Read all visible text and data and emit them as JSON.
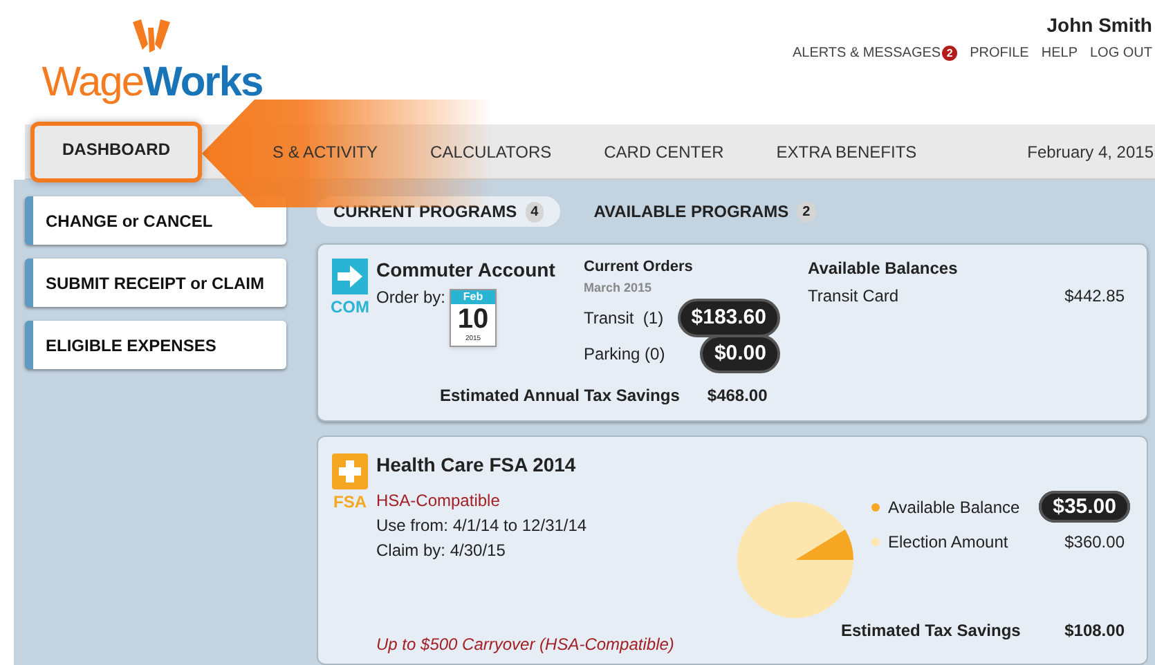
{
  "logo": {
    "part1": "Wage",
    "part2": "Works"
  },
  "user": {
    "name": "John Smith"
  },
  "top_links": [
    {
      "label": "ALERTS & MESSAGES",
      "badge": "2"
    },
    {
      "label": "PROFILE"
    },
    {
      "label": "HELP"
    },
    {
      "label": "LOG OUT"
    }
  ],
  "nav": {
    "items": [
      {
        "label": "DASHBOARD",
        "selected": true
      },
      {
        "label": "S & ACTIVITY",
        "selected": false
      },
      {
        "label": "CALCULATORS",
        "selected": false
      },
      {
        "label": "CARD CENTER",
        "selected": false
      },
      {
        "label": "EXTRA BENEFITS",
        "selected": false
      }
    ],
    "date": "February 4, 2015"
  },
  "sidebar": {
    "items": [
      {
        "label": "CHANGE or CANCEL"
      },
      {
        "label": "SUBMIT RECEIPT or CLAIM"
      },
      {
        "label": "ELIGIBLE EXPENSES"
      }
    ]
  },
  "tabs": [
    {
      "label": "CURRENT PROGRAMS",
      "count": "4",
      "selected": true
    },
    {
      "label": "AVAILABLE PROGRAMS",
      "count": "2",
      "selected": false
    }
  ],
  "commuter": {
    "title": "Commuter Account",
    "code": "COM",
    "order_by": "Order by:",
    "calendar": {
      "month": "Feb",
      "day": "10",
      "year": "2015"
    },
    "orders_title": "Current Orders",
    "orders_period": "March 2015",
    "orders": [
      {
        "label": "Transit  (1)",
        "amount": "$183.60"
      },
      {
        "label": "Parking (0)",
        "amount": "$0.00"
      }
    ],
    "balances_title": "Available Balances",
    "balances": [
      {
        "label": "Transit Card",
        "amount": "$442.85"
      }
    ],
    "savings_label": "Estimated Annual Tax Savings",
    "savings": "$468.00"
  },
  "fsa": {
    "title": "Health Care FSA 2014",
    "code": "FSA",
    "subtitle": "HSA-Compatible",
    "use_from": "Use from: 4/1/14 to 12/31/14",
    "claim_by": "Claim by: 4/30/15",
    "carryover": "Up to $500 Carryover (HSA-Compatible)",
    "legend": [
      {
        "label": "Available Balance",
        "amount": "$35.00",
        "color": "#f5a623",
        "highlight": true
      },
      {
        "label": "Election Amount",
        "amount": "$360.00",
        "color": "#fde6ad",
        "highlight": false
      }
    ],
    "savings_label": "Estimated Tax Savings",
    "savings": "$108.00"
  }
}
